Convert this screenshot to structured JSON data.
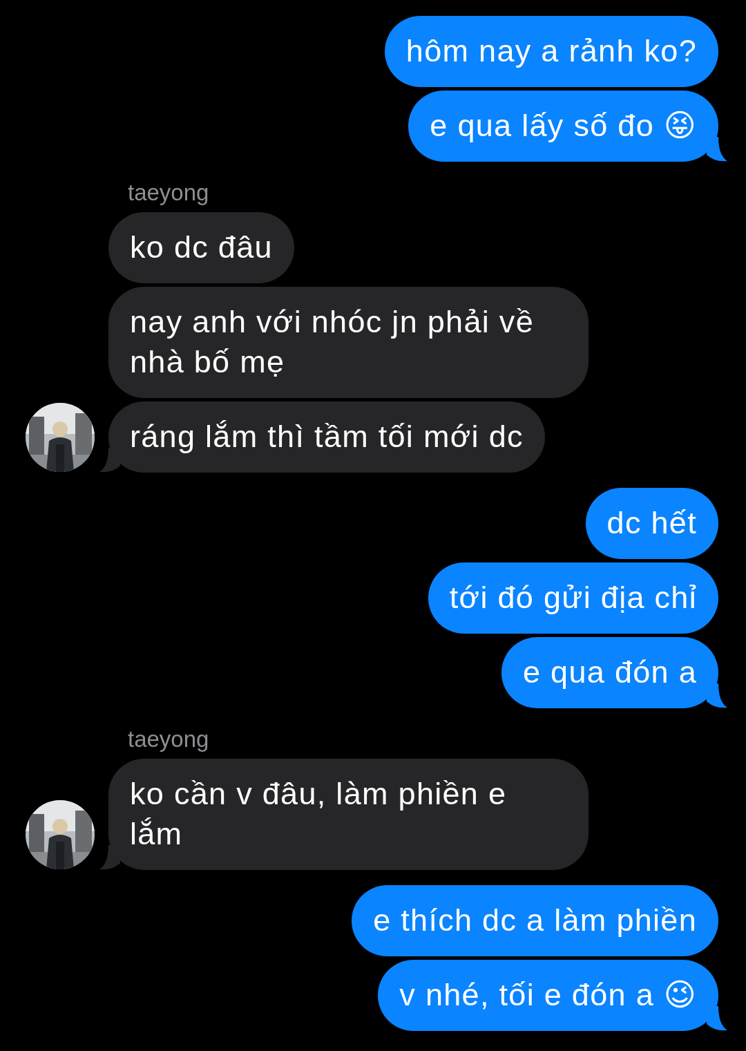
{
  "groups": [
    {
      "kind": "sent",
      "messages": [
        "hôm nay a rảnh ko?",
        "e qua lấy số đo 😝"
      ]
    },
    {
      "kind": "received",
      "sender": "taeyong",
      "avatar": {
        "kind": "picture"
      },
      "messages": [
        "ko dc đâu",
        "nay anh với nhóc jn phải về nhà bố mẹ",
        "ráng lắm thì tầm tối mới dc"
      ]
    },
    {
      "kind": "sent",
      "messages": [
        "dc hết",
        "tới đó gửi địa chỉ",
        "e qua đón a"
      ]
    },
    {
      "kind": "received",
      "sender": "taeyong",
      "avatar": {
        "kind": "picture"
      },
      "messages": [
        "ko cần v đâu, làm phiền e lắm"
      ]
    },
    {
      "kind": "sent",
      "messages": [
        "e thích dc a làm phiền",
        "v nhé, tối e đón a 😉"
      ]
    }
  ]
}
